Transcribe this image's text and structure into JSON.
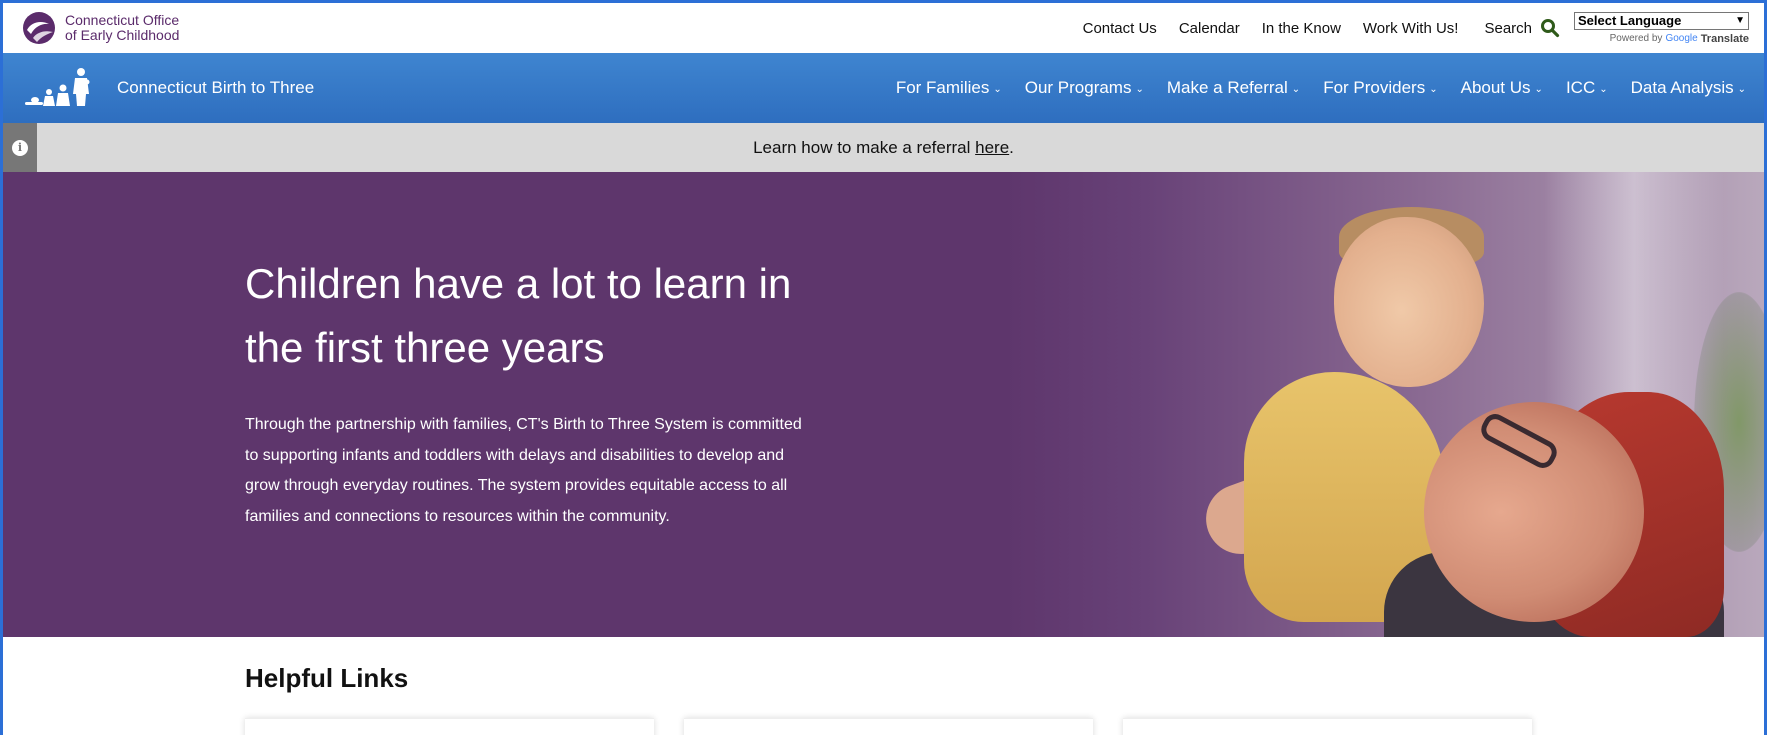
{
  "topbar": {
    "logo_line1": "Connecticut Office",
    "logo_line2": "of Early Childhood",
    "links": [
      "Contact Us",
      "Calendar",
      "In the Know",
      "Work With Us!"
    ],
    "search_label": "Search",
    "language_select": "Select Language",
    "powered_by": "Powered by",
    "google": "Google",
    "translate": "Translate"
  },
  "mainnav": {
    "brand_name": "Connecticut Birth to Three",
    "items": [
      "For Families",
      "Our Programs",
      "Make a Referral",
      "For Providers",
      "About Us",
      "ICC",
      "Data Analysis"
    ]
  },
  "alert": {
    "text": "Learn how to make a referral ",
    "link": "here",
    "suffix": "."
  },
  "hero": {
    "title_line1": "Children have a lot to learn in",
    "title_line2": "the first three years",
    "body": "Through the partnership with families, CT's Birth to Three System is committed to supporting infants and toddlers with delays and disabilities to develop and grow through everyday routines. The system provides equitable access to all families and connections to resources within the community."
  },
  "helpful_links": {
    "title": "Helpful Links"
  },
  "colors": {
    "nav_blue": "#2e6ebf",
    "hero_purple": "#5e366c",
    "alert_gray": "#d9d9d9",
    "logo_purple": "#5b2b6b"
  }
}
